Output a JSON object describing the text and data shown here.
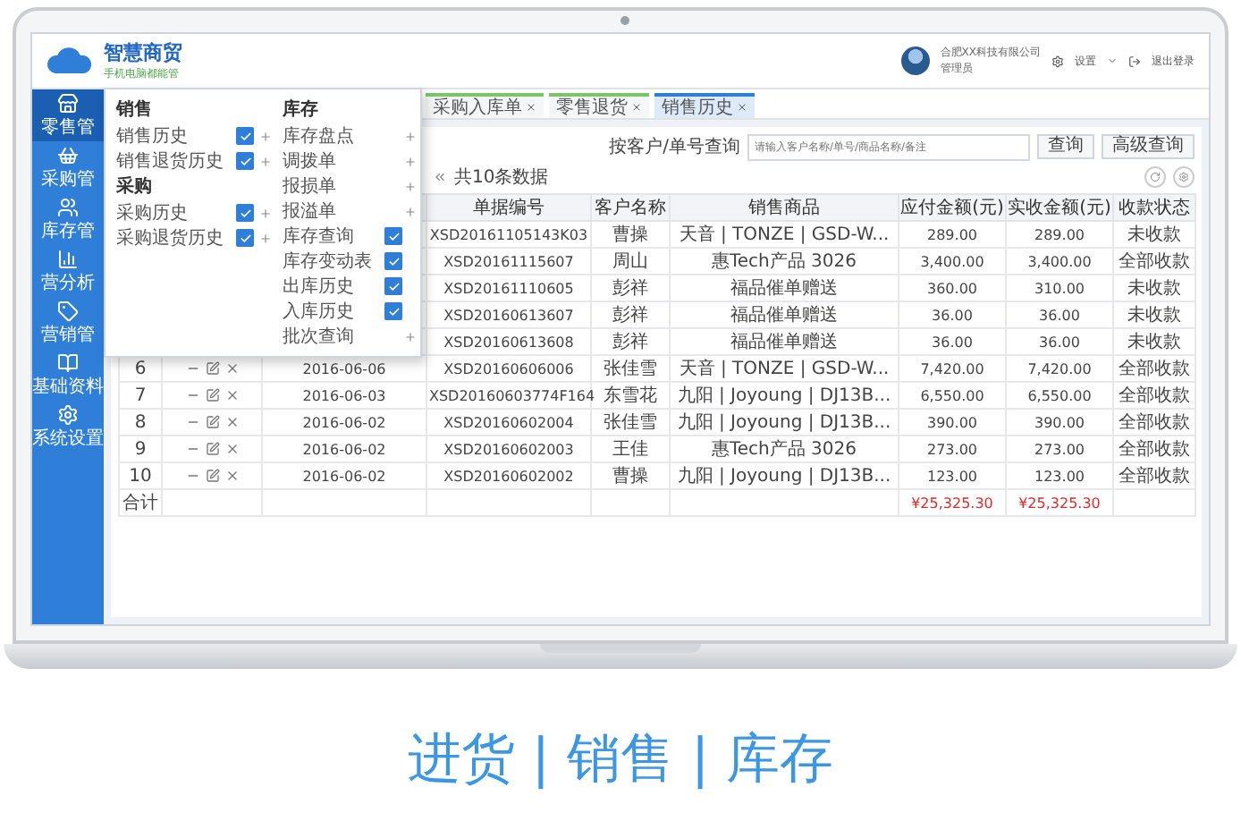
{
  "header": {
    "brand": "智慧商贸",
    "slogan": "手机电脑都能管",
    "company": "合肥XX科技有限公司",
    "role": "管理员",
    "settings": "设置",
    "logout": "退出登录"
  },
  "sidebar": [
    {
      "label": "零售管",
      "kind": "store",
      "selected": true
    },
    {
      "label": "采购管",
      "kind": "basket",
      "selected": false
    },
    {
      "label": "库存管",
      "kind": "people",
      "selected": false
    },
    {
      "label": "营分析",
      "kind": "chart",
      "selected": false
    },
    {
      "label": "营销管",
      "kind": "tag",
      "selected": false
    },
    {
      "label": "基础资料",
      "kind": "book",
      "selected": false
    },
    {
      "label": "系统设置",
      "kind": "gear",
      "selected": false
    }
  ],
  "tabs": [
    {
      "label": "采购入库单",
      "selected": false
    },
    {
      "label": "零售退货",
      "selected": false
    },
    {
      "label": "销售历史",
      "selected": true
    }
  ],
  "toolbar": {
    "search_label": "按客户/单号查询",
    "placeholder": "请输入客户名称/单号/商品名称/备注",
    "buttons": [
      "查询",
      "高级查询"
    ]
  },
  "pager": "共10条数据",
  "menu": {
    "columns": [
      {
        "groups": [
          {
            "title": "销售",
            "items": [
              {
                "label": "销售历史",
                "kind": "check-add",
                "checked": true
              },
              {
                "label": "销售退货历史",
                "kind": "check-add",
                "checked": true
              }
            ]
          },
          {
            "title": "采购",
            "items": [
              {
                "label": "采购历史",
                "kind": "check-add",
                "checked": true
              },
              {
                "label": "采购退货历史",
                "kind": "check-add",
                "checked": true
              }
            ]
          }
        ]
      },
      {
        "groups": [
          {
            "title": "库存",
            "items": [
              {
                "label": "库存盘点",
                "kind": "add"
              },
              {
                "label": "调拨单",
                "kind": "add"
              },
              {
                "label": "报损单",
                "kind": "add"
              },
              {
                "label": "报溢单",
                "kind": "add"
              },
              {
                "label": "库存查询",
                "kind": "check",
                "checked": true
              },
              {
                "label": "库存变动表",
                "kind": "check",
                "checked": true
              },
              {
                "label": "出库历史",
                "kind": "check",
                "checked": true
              },
              {
                "label": "入库历史",
                "kind": "check",
                "checked": true
              },
              {
                "label": "批次查询",
                "kind": "add"
              }
            ]
          }
        ]
      }
    ]
  },
  "table": {
    "columns": [
      {},
      {},
      {},
      {
        "label": "单据编号"
      },
      {
        "label": "客户名称"
      },
      {
        "label": "销售商品"
      },
      {
        "label": "应付金额(元)"
      },
      {
        "label": "实收金额(元)"
      },
      {
        "label": "收款状态"
      }
    ],
    "rows": [
      {
        "id": "XSD20161105143K03",
        "customer": "曹操",
        "goods": "天音 | TONZE | GSD-W...",
        "due": "289.00",
        "paid": "289.00",
        "status": "未收款"
      },
      {
        "id": "XSD20161115607",
        "customer": "周山",
        "goods": "惠Tech产品 3026",
        "due": "3,400.00",
        "paid": "3,400.00",
        "status": "全部收款"
      },
      {
        "id": "XSD20161110605",
        "customer": "彭祥",
        "goods": "福品催单赠送",
        "due": "360.00",
        "paid": "310.00",
        "status": "未收款"
      },
      {
        "id": "XSD20160613607",
        "customer": "彭祥",
        "goods": "福品催单赠送",
        "due": "36.00",
        "paid": "36.00",
        "status": "未收款"
      },
      {
        "id": "XSD20160613608",
        "customer": "彭祥",
        "goods": "福品催单赠送",
        "due": "36.00",
        "paid": "36.00",
        "status": "未收款"
      },
      {
        "no": "6",
        "date": "2016-06-06",
        "id": "XSD20160606006",
        "customer": "张佳雪",
        "goods": "天音 | TONZE | GSD-W...",
        "due": "7,420.00",
        "paid": "7,420.00",
        "status": "全部收款"
      },
      {
        "no": "7",
        "date": "2016-06-03",
        "id": "XSD20160603774F164",
        "customer": "东雪花",
        "goods": "九阳 | Joyoung | DJ13B...",
        "due": "6,550.00",
        "paid": "6,550.00",
        "status": "全部收款"
      },
      {
        "no": "8",
        "date": "2016-06-02",
        "id": "XSD20160602004",
        "customer": "张佳雪",
        "goods": "九阳 | Joyoung | DJ13B...",
        "due": "390.00",
        "paid": "390.00",
        "status": "全部收款"
      },
      {
        "no": "9",
        "date": "2016-06-02",
        "id": "XSD20160602003",
        "customer": "王佳",
        "goods": "惠Tech产品 3026",
        "due": "273.00",
        "paid": "273.00",
        "status": "全部收款"
      },
      {
        "no": "10",
        "date": "2016-06-02",
        "id": "XSD20160602002",
        "customer": "曹操",
        "goods": "九阳 | Joyoung | DJ13B...",
        "due": "123.00",
        "paid": "123.00",
        "status": "全部收款"
      }
    ],
    "total": {
      "label": "合计",
      "due": "¥25,325.30",
      "paid": "¥25,325.30"
    }
  },
  "promo": {
    "headline": "进货 | 销售 | 库存"
  }
}
